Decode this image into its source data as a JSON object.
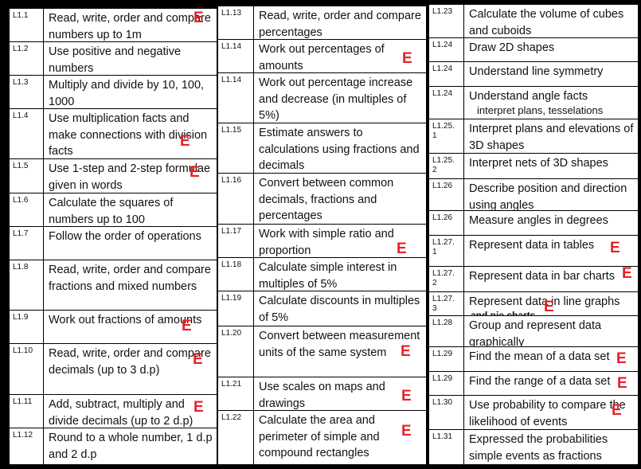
{
  "columns": [
    {
      "rows": [
        {
          "code": "L1.1",
          "text": "Read, write, order and compare numbers up to 1m",
          "mark": "E"
        },
        {
          "code": "L1.2",
          "text": "Use positive and negative numbers"
        },
        {
          "code": "L1.3",
          "text": "Multiply and divide by 10, 100, 1000"
        },
        {
          "code": "L1.4",
          "text": "Use multiplication facts and make connections with division facts",
          "mark": "E"
        },
        {
          "code": "L1.5",
          "text": "Use 1-step and 2-step formulae given in words",
          "mark": "E"
        },
        {
          "code": "L1.6",
          "text": "Calculate the squares of numbers up to 100"
        },
        {
          "code": "L1.7",
          "text": "Follow the order of operations"
        },
        {
          "code": "L1.8",
          "text": "Read, write, order and compare fractions and mixed numbers"
        },
        {
          "code": "L1.9",
          "text": "Work out fractions of amounts",
          "mark": "E"
        },
        {
          "code": "L1.10",
          "text": "Read, write, order and compare decimals (up to 3 d.p)",
          "mark": "E"
        },
        {
          "code": "L1.11",
          "text": "Add, subtract, multiply and divide decimals (up to 2 d.p)",
          "mark": "E"
        },
        {
          "code": "L1.12",
          "text": "Round to a whole number, 1 d.p and 2 d.p"
        }
      ]
    },
    {
      "rows": [
        {
          "code": "L1.13",
          "text": "Read, write, order and compare percentages"
        },
        {
          "code": "L1.14",
          "text": "Work out percentages of amounts",
          "mark": "E"
        },
        {
          "code": "L1.14",
          "text": "Work out percentage increase and decrease (in multiples of 5%)"
        },
        {
          "code": "L1.15",
          "text": "Estimate answers to calculations using fractions and decimals"
        },
        {
          "code": "L1.16",
          "text": "Convert between common decimals, fractions and percentages"
        },
        {
          "code": "L1.17",
          "text": "Work with simple ratio and proportion",
          "mark": "E"
        },
        {
          "code": "L1.18",
          "text": "Calculate simple interest in multiples of 5%"
        },
        {
          "code": "L1.19",
          "text": "Calculate discounts in multiples of 5%"
        },
        {
          "code": "L1.20",
          "text": "Convert between measurement units of the same system",
          "mark": "E"
        },
        {
          "code": "L1.21",
          "text": "Use scales on maps and drawings",
          "mark": "E"
        },
        {
          "code": "L1.22",
          "text": "Calculate the area and perimeter of simple and compound rectangles",
          "mark": "E"
        }
      ]
    },
    {
      "rows": [
        {
          "code": "L1.23",
          "text": "Calculate the volume of cubes and cuboids"
        },
        {
          "code": "L1.24",
          "text": "Draw 2D shapes"
        },
        {
          "code": "L1.24",
          "text": "Understand line symmetry"
        },
        {
          "code": "L1.24",
          "text": "Understand  angle facts",
          "note": "interpret plans, tesselations"
        },
        {
          "code": "L1.25.1",
          "text": "Interpret plans and elevations of 3D shapes"
        },
        {
          "code": "L1.25.2",
          "text": "Interpret nets of 3D shapes"
        },
        {
          "code": "L1.26",
          "text": "Describe position and direction using angles"
        },
        {
          "code": "L1.26",
          "text": "Measure angles in degrees"
        },
        {
          "code": "L1.27.1",
          "text": "Represent data in tables",
          "mark": "E"
        },
        {
          "code": "L1.27.2",
          "text": "Represent data in bar charts",
          "mark": "E"
        },
        {
          "code": "L1.27.3",
          "text": "Represent data in line graphs",
          "bold_note": "and pie charts",
          "mark": "E"
        },
        {
          "code": "L1.28",
          "text": "Group and represent data graphically"
        },
        {
          "code": "L1.29",
          "text": "Find the mean of a data set",
          "mark": "E"
        },
        {
          "code": "L1.29",
          "text": "Find the range of a data set",
          "mark": "E"
        },
        {
          "code": "L1.30",
          "text": "Use probability to compare the likelihood of events",
          "mark": "E"
        },
        {
          "code": "L1.31",
          "text": "Expressed the probabilities simple events as fractions"
        }
      ]
    }
  ],
  "colors": {
    "mark": "#e8202a",
    "background": "#000000"
  }
}
